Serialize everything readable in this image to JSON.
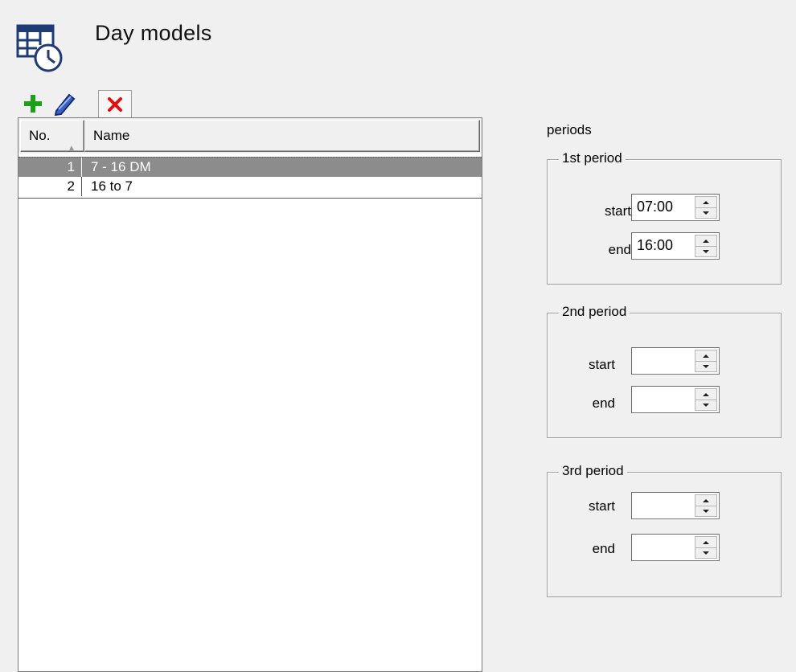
{
  "header": {
    "title": "Day models",
    "icon": "calendar-clock-icon"
  },
  "toolbar": {
    "add_icon": "plus-icon",
    "edit_icon": "pencil-icon",
    "delete_icon": "delete-x-icon",
    "colors": {
      "add": "#1aa01a",
      "delete": "#e01010",
      "edit": "#1e3c96"
    }
  },
  "list": {
    "columns": [
      "No.",
      "Name"
    ],
    "sort_indicator": "▲",
    "rows": [
      {
        "no": "1",
        "name": "7 - 16 DM",
        "selected": true
      },
      {
        "no": "2",
        "name": "16 to 7",
        "selected": false
      }
    ]
  },
  "periods": {
    "label": "periods",
    "groups": [
      {
        "title": "1st period",
        "start_label": "start",
        "end_label": "end",
        "start": "07:00",
        "end": "16:00"
      },
      {
        "title": "2nd period",
        "start_label": "start",
        "end_label": "end",
        "start": "",
        "end": ""
      },
      {
        "title": "3rd period",
        "start_label": "start",
        "end_label": "end",
        "start": "",
        "end": ""
      }
    ]
  }
}
